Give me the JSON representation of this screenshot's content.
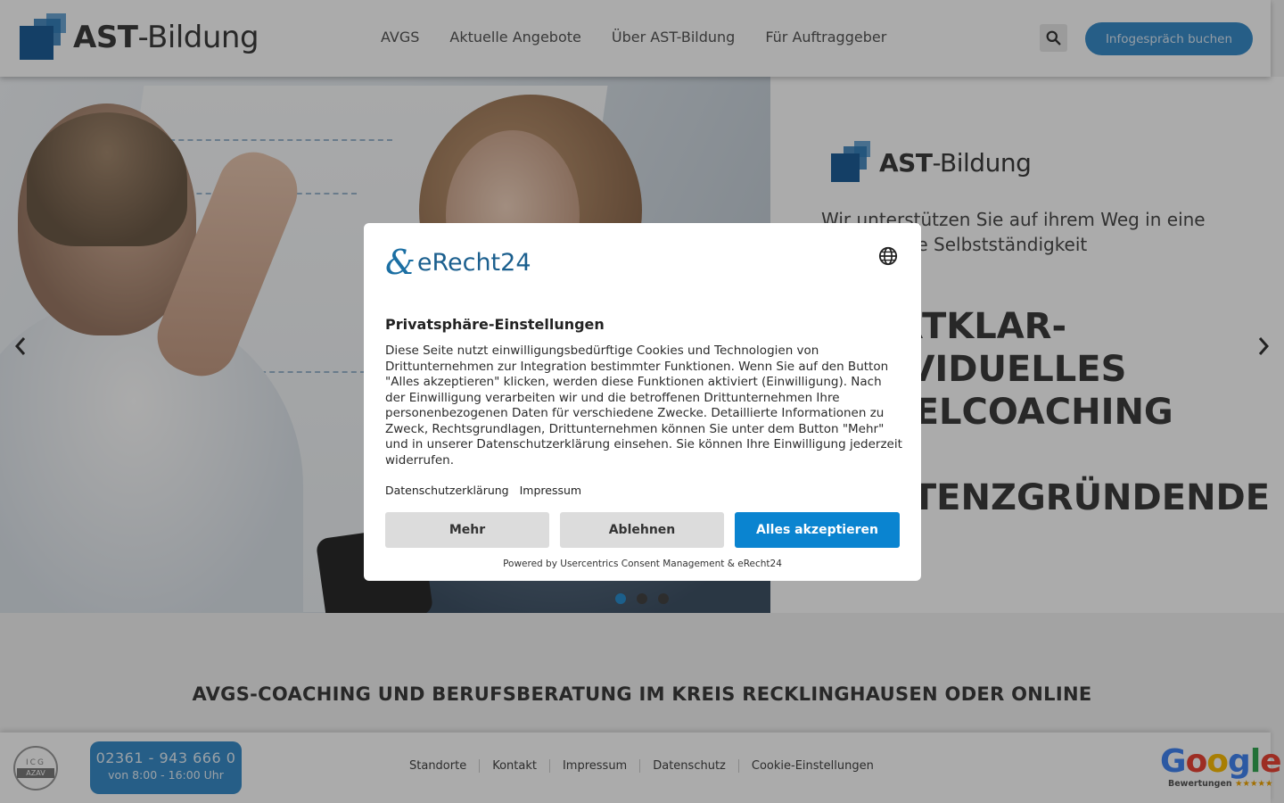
{
  "header": {
    "logo_bold": "AST",
    "logo_rest": "-Bildung",
    "nav": [
      "AVGS",
      "Aktuelle Angebote",
      "Über AST-Bildung",
      "Für Auftraggeber"
    ],
    "search_icon": "search-icon",
    "cta_label": "Infogespräch buchen"
  },
  "hero": {
    "logo_bold": "AST",
    "logo_rest": "-Bildung",
    "tagline": "Wir unterstützen Sie auf ihrem Weg in eine erfolgreiche Selbstständigkeit",
    "headline": "STARTKLAR-INDIVIDUELLES EINZELCOACHING FÜR EXISTENZGRÜNDENDE",
    "prev_icon": "chevron-left-icon",
    "next_icon": "chevron-right-icon",
    "slides": 3,
    "active_slide": 1
  },
  "section": {
    "title": "AVGS-COACHING UND BERUFSBERATUNG IM KREIS RECKLINGHAUSEN ODER ONLINE"
  },
  "footer": {
    "azav_top": "ICG",
    "azav_label": "AZAV",
    "phone": "02361 - 943 666 0",
    "hours": "von 8:00 - 16:00 Uhr",
    "links": [
      "Standorte",
      "Kontakt",
      "Impressum",
      "Datenschutz",
      "Cookie-Einstellungen"
    ],
    "google": "Google",
    "google_sub": "Bewertungen",
    "google_stars": "★★★★★"
  },
  "consent": {
    "brand": "eRecht24",
    "title": "Privatsphäre-Einstellungen",
    "body": "Diese Seite nutzt einwilligungsbedürftige Cookies und Technologien von Drittunternehmen zur Integration bestimmter Funktionen. Wenn Sie auf den Button \"Alles akzeptieren\" klicken, werden diese Funktionen aktiviert (Einwilligung). Nach der Einwilligung verarbeiten wir und die betroffenen Drittunternehmen Ihre personenbezogenen Daten für verschiedene Zwecke. Detaillierte Informationen zu Zweck, Rechtsgrundlagen, Drittunternehmen können Sie unter dem Button \"Mehr\" und in unserer Datenschutzerklärung einsehen. Sie können Ihre Einwilligung jederzeit widerrufen.",
    "link_privacy": "Datenschutzerklärung",
    "link_imprint": "Impressum",
    "btn_more": "Mehr",
    "btn_decline": "Ablehnen",
    "btn_accept": "Alles akzeptieren",
    "powered": "Powered by Usercentrics Consent Management & eRecht24",
    "language_icon": "globe-icon"
  },
  "colors": {
    "brand_blue": "#3a8cc9",
    "accept_blue": "#0a84d0",
    "logo_blue": "#1f5f99"
  }
}
